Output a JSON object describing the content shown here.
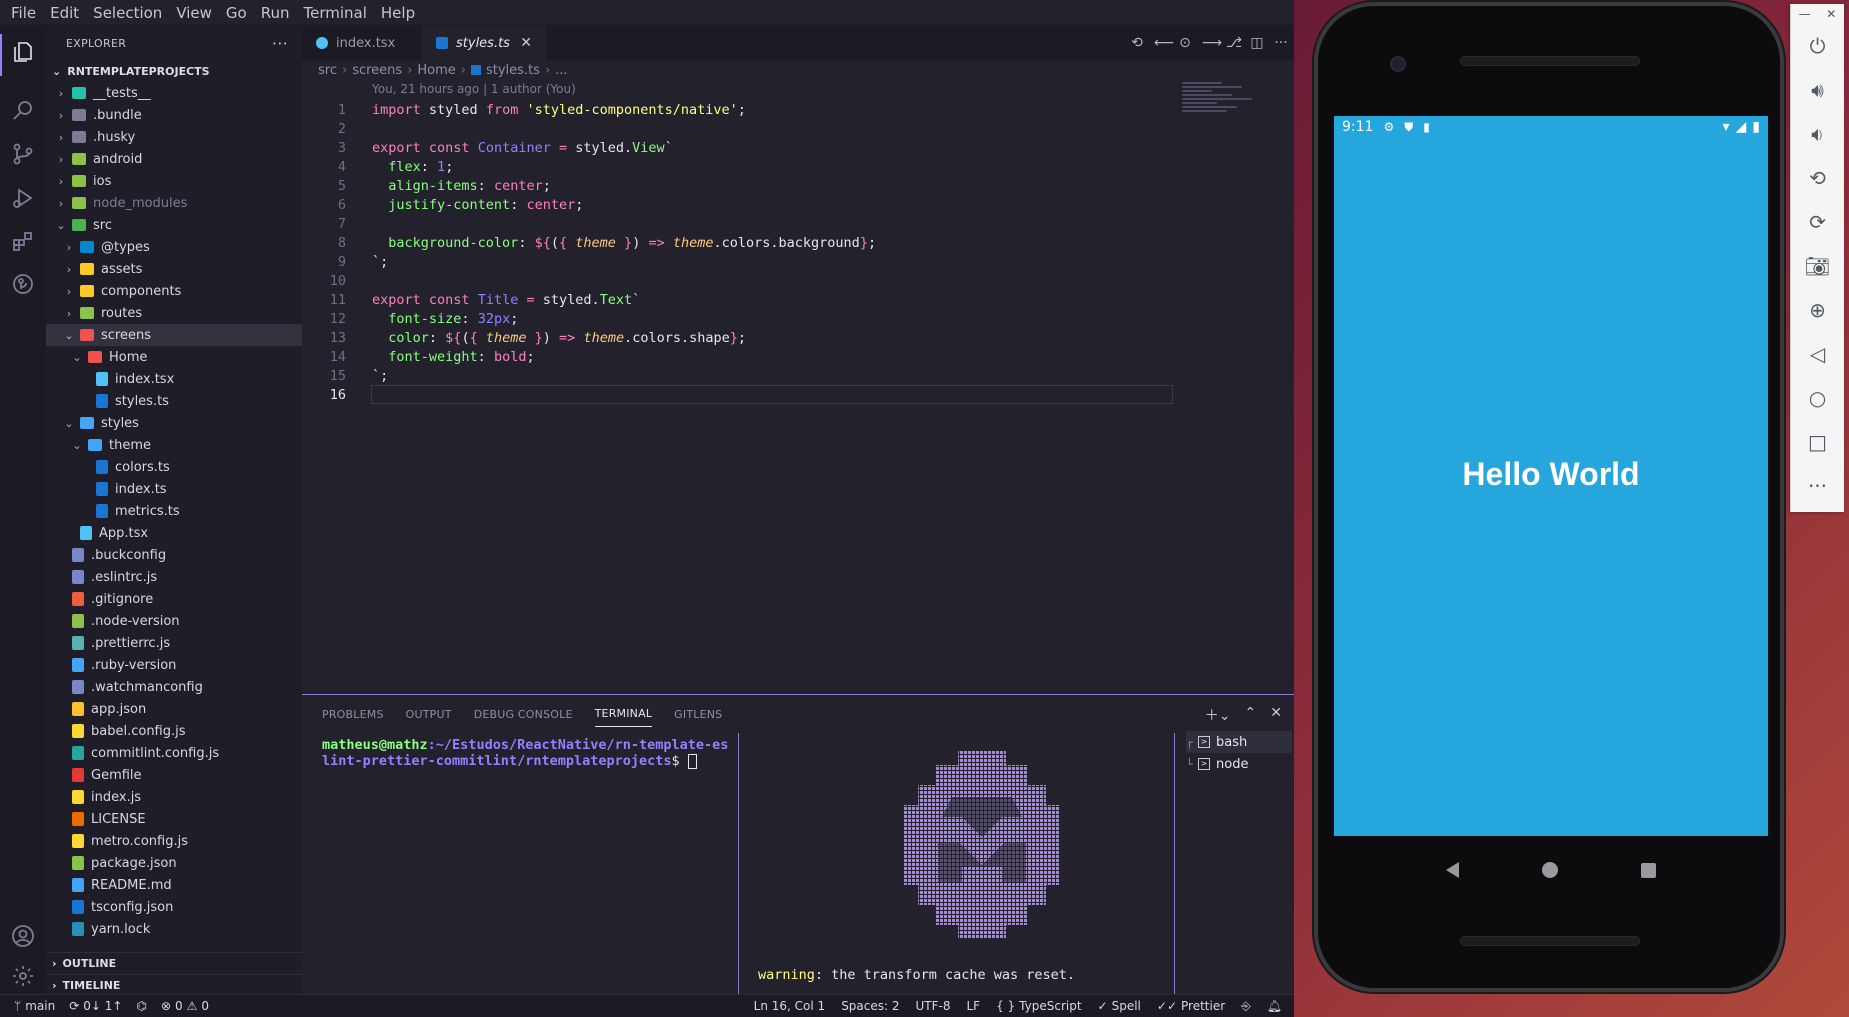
{
  "menubar": [
    "File",
    "Edit",
    "Selection",
    "View",
    "Go",
    "Run",
    "Terminal",
    "Help"
  ],
  "explorer": {
    "header": "EXPLORER",
    "project": "RNTEMPLATEPROJECTS",
    "items": [
      {
        "label": "__tests__",
        "type": "folder",
        "depth": 0,
        "open": false,
        "color": "#22c3a6"
      },
      {
        "label": ".bundle",
        "type": "folder",
        "depth": 0,
        "open": false,
        "color": "#7b7d95"
      },
      {
        "label": ".husky",
        "type": "folder",
        "depth": 0,
        "open": false,
        "color": "#7b7d95"
      },
      {
        "label": "android",
        "type": "folder",
        "depth": 0,
        "open": false,
        "color": "#8bc34a"
      },
      {
        "label": "ios",
        "type": "folder",
        "depth": 0,
        "open": false,
        "color": "#8bc34a"
      },
      {
        "label": "node_modules",
        "type": "folder",
        "depth": 0,
        "open": false,
        "color": "#8bc34a",
        "dim": true
      },
      {
        "label": "src",
        "type": "folder",
        "depth": 0,
        "open": true,
        "color": "#4caf50"
      },
      {
        "label": "@types",
        "type": "folder",
        "depth": 1,
        "open": false,
        "color": "#0288d1"
      },
      {
        "label": "assets",
        "type": "folder",
        "depth": 1,
        "open": false,
        "color": "#ffca28"
      },
      {
        "label": "components",
        "type": "folder",
        "depth": 1,
        "open": false,
        "color": "#ffca28"
      },
      {
        "label": "routes",
        "type": "folder",
        "depth": 1,
        "open": false,
        "color": "#8bc34a"
      },
      {
        "label": "screens",
        "type": "folder",
        "depth": 1,
        "open": true,
        "color": "#ef5350",
        "selected": true
      },
      {
        "label": "Home",
        "type": "folder",
        "depth": 2,
        "open": true,
        "color": "#ef5350"
      },
      {
        "label": "index.tsx",
        "type": "file",
        "depth": 3,
        "color": "#4fc3f7"
      },
      {
        "label": "styles.ts",
        "type": "file",
        "depth": 3,
        "color": "#1976d2"
      },
      {
        "label": "styles",
        "type": "folder",
        "depth": 1,
        "open": true,
        "color": "#42a5f5"
      },
      {
        "label": "theme",
        "type": "folder",
        "depth": 2,
        "open": true,
        "color": "#42a5f5"
      },
      {
        "label": "colors.ts",
        "type": "file",
        "depth": 3,
        "color": "#1976d2"
      },
      {
        "label": "index.ts",
        "type": "file",
        "depth": 3,
        "color": "#1976d2"
      },
      {
        "label": "metrics.ts",
        "type": "file",
        "depth": 3,
        "color": "#1976d2"
      },
      {
        "label": "App.tsx",
        "type": "file",
        "depth": 1,
        "color": "#4fc3f7"
      },
      {
        "label": ".buckconfig",
        "type": "file",
        "depth": 0,
        "color": "#7986cb"
      },
      {
        "label": ".eslintrc.js",
        "type": "file",
        "depth": 0,
        "color": "#7986cb"
      },
      {
        "label": ".gitignore",
        "type": "file",
        "depth": 0,
        "color": "#ef5f3c"
      },
      {
        "label": ".node-version",
        "type": "file",
        "depth": 0,
        "color": "#8bc34a"
      },
      {
        "label": ".prettierrc.js",
        "type": "file",
        "depth": 0,
        "color": "#56b3b4"
      },
      {
        "label": ".ruby-version",
        "type": "file",
        "depth": 0,
        "color": "#42a5f5"
      },
      {
        "label": ".watchmanconfig",
        "type": "file",
        "depth": 0,
        "color": "#7986cb"
      },
      {
        "label": "app.json",
        "type": "file",
        "depth": 0,
        "color": "#fbc02d"
      },
      {
        "label": "babel.config.js",
        "type": "file",
        "depth": 0,
        "color": "#fdd835"
      },
      {
        "label": "commitlint.config.js",
        "type": "file",
        "depth": 0,
        "color": "#26a69a"
      },
      {
        "label": "Gemfile",
        "type": "file",
        "depth": 0,
        "color": "#e53935"
      },
      {
        "label": "index.js",
        "type": "file",
        "depth": 0,
        "color": "#fdd835"
      },
      {
        "label": "LICENSE",
        "type": "file",
        "depth": 0,
        "color": "#ef6c00"
      },
      {
        "label": "metro.config.js",
        "type": "file",
        "depth": 0,
        "color": "#fdd835"
      },
      {
        "label": "package.json",
        "type": "file",
        "depth": 0,
        "color": "#8bc34a"
      },
      {
        "label": "README.md",
        "type": "file",
        "depth": 0,
        "color": "#42a5f5"
      },
      {
        "label": "tsconfig.json",
        "type": "file",
        "depth": 0,
        "color": "#1976d2"
      },
      {
        "label": "yarn.lock",
        "type": "file",
        "depth": 0,
        "color": "#2c8ebb"
      }
    ],
    "outline": "OUTLINE",
    "timeline": "TIMELINE"
  },
  "tabs": [
    {
      "label": "index.tsx",
      "active": false,
      "icon_color": "#4fc3f7"
    },
    {
      "label": "styles.ts",
      "active": true,
      "icon_color": "#1976d2"
    }
  ],
  "breadcrumb": [
    "src",
    "screens",
    "Home",
    "styles.ts",
    "..."
  ],
  "blame": "You, 21 hours ago | 1 author (You)",
  "code_lines": [
    [
      [
        "kw",
        "import"
      ],
      [
        "pun",
        " styled "
      ],
      [
        "kw",
        "from"
      ],
      [
        "pun",
        " "
      ],
      [
        "str",
        "'styled-components/native'"
      ],
      [
        "pun",
        ";"
      ]
    ],
    [],
    [
      [
        "kw",
        "export"
      ],
      [
        "pun",
        " "
      ],
      [
        "kw",
        "const"
      ],
      [
        "pun",
        " "
      ],
      [
        "cls",
        "Container"
      ],
      [
        "pun",
        " "
      ],
      [
        "kw",
        "="
      ],
      [
        "pun",
        " styled."
      ],
      [
        "fn",
        "View"
      ],
      [
        "pun",
        "`"
      ]
    ],
    [
      [
        "pun",
        "  "
      ],
      [
        "prop",
        "flex"
      ],
      [
        "pun",
        ": "
      ],
      [
        "cls",
        "1"
      ],
      [
        "pun",
        ";"
      ]
    ],
    [
      [
        "pun",
        "  "
      ],
      [
        "prop",
        "align-items"
      ],
      [
        "pun",
        ": "
      ],
      [
        "pk",
        "center"
      ],
      [
        "pun",
        ";"
      ]
    ],
    [
      [
        "pun",
        "  "
      ],
      [
        "prop",
        "justify-content"
      ],
      [
        "pun",
        ": "
      ],
      [
        "pk",
        "center"
      ],
      [
        "pun",
        ";"
      ]
    ],
    [],
    [
      [
        "pun",
        "  "
      ],
      [
        "prop",
        "background-color"
      ],
      [
        "pun",
        ": "
      ],
      [
        "pk",
        "${"
      ],
      [
        "pun",
        "("
      ],
      [
        "pk",
        "{"
      ],
      [
        "pun",
        " "
      ],
      [
        "par",
        "theme"
      ],
      [
        "pun",
        " "
      ],
      [
        "pk",
        "}"
      ],
      [
        "pun",
        ") "
      ],
      [
        "kw",
        "=>"
      ],
      [
        "pun",
        " "
      ],
      [
        "par",
        "theme"
      ],
      [
        "pun",
        ".colors.background"
      ],
      [
        "pk",
        "}"
      ],
      [
        "pun",
        ";"
      ]
    ],
    [
      [
        "pun",
        "`;"
      ]
    ],
    [],
    [
      [
        "kw",
        "export"
      ],
      [
        "pun",
        " "
      ],
      [
        "kw",
        "const"
      ],
      [
        "pun",
        " "
      ],
      [
        "cls",
        "Title"
      ],
      [
        "pun",
        " "
      ],
      [
        "kw",
        "="
      ],
      [
        "pun",
        " styled."
      ],
      [
        "fn",
        "Text"
      ],
      [
        "pun",
        "`"
      ]
    ],
    [
      [
        "pun",
        "  "
      ],
      [
        "prop",
        "font-size"
      ],
      [
        "pun",
        ": "
      ],
      [
        "cls",
        "32px"
      ],
      [
        "pun",
        ";"
      ]
    ],
    [
      [
        "pun",
        "  "
      ],
      [
        "prop",
        "color"
      ],
      [
        "pun",
        ": "
      ],
      [
        "pk",
        "${"
      ],
      [
        "pun",
        "("
      ],
      [
        "pk",
        "{"
      ],
      [
        "pun",
        " "
      ],
      [
        "par",
        "theme"
      ],
      [
        "pun",
        " "
      ],
      [
        "pk",
        "}"
      ],
      [
        "pun",
        ") "
      ],
      [
        "kw",
        "=>"
      ],
      [
        "pun",
        " "
      ],
      [
        "par",
        "theme"
      ],
      [
        "pun",
        ".colors.shape"
      ],
      [
        "pk",
        "}"
      ],
      [
        "pun",
        ";"
      ]
    ],
    [
      [
        "pun",
        "  "
      ],
      [
        "prop",
        "font-weight"
      ],
      [
        "pun",
        ": "
      ],
      [
        "pk",
        "bold"
      ],
      [
        "pun",
        ";"
      ]
    ],
    [
      [
        "pun",
        "`;"
      ]
    ],
    []
  ],
  "panel": {
    "tabs": [
      "PROBLEMS",
      "OUTPUT",
      "DEBUG CONSOLE",
      "TERMINAL",
      "GITLENS"
    ],
    "active_tab": "TERMINAL",
    "prompt_user": "matheus@mathz",
    "prompt_path_1": ":~/Estudos/ReactNative/rn-template-es",
    "prompt_path_2": "lint-prettier-commitlint/rntemplateprojects",
    "prompt_end": "$ ",
    "warning_label": "warning",
    "warning_text": ": the transform cache was reset.",
    "terminals": [
      "bash",
      "node"
    ]
  },
  "statusbar": {
    "branch": "main",
    "sync": "0↓ 1↑",
    "errors": "0",
    "warnings": "0",
    "position": "Ln 16, Col 1",
    "spaces": "Spaces: 2",
    "encoding": "UTF-8",
    "eol": "LF",
    "language": "TypeScript",
    "spell": "Spell",
    "prettier": "Prettier"
  },
  "phone": {
    "time": "9:11",
    "app_text": "Hello World",
    "screen_color": "#25a6dd"
  }
}
